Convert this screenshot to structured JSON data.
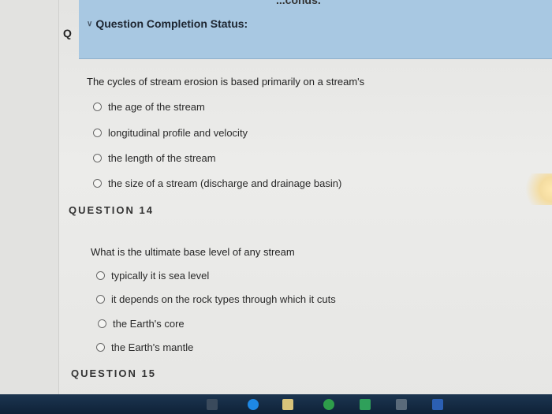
{
  "header": {
    "top_cut_text": "...conds.",
    "status_title": "Question Completion Status:",
    "rail_letter": "Q"
  },
  "question13": {
    "text": "The cycles of stream erosion is based primarily on a stream's",
    "options": [
      "the age of the stream",
      "longitudinal profile and velocity",
      "the length of the stream",
      "the size of a stream (discharge and drainage basin)"
    ]
  },
  "question14": {
    "heading": "QUESTION 14",
    "text": "What is the ultimate base level of any stream",
    "options": [
      "typically it is sea level",
      "it depends on the rock types through which it cuts",
      "the Earth's core",
      "the Earth's mantle"
    ]
  },
  "question15": {
    "heading": "QUESTION 15"
  },
  "colors": {
    "status_bar": "#a8c8e2",
    "taskbar": "#0f2238"
  }
}
